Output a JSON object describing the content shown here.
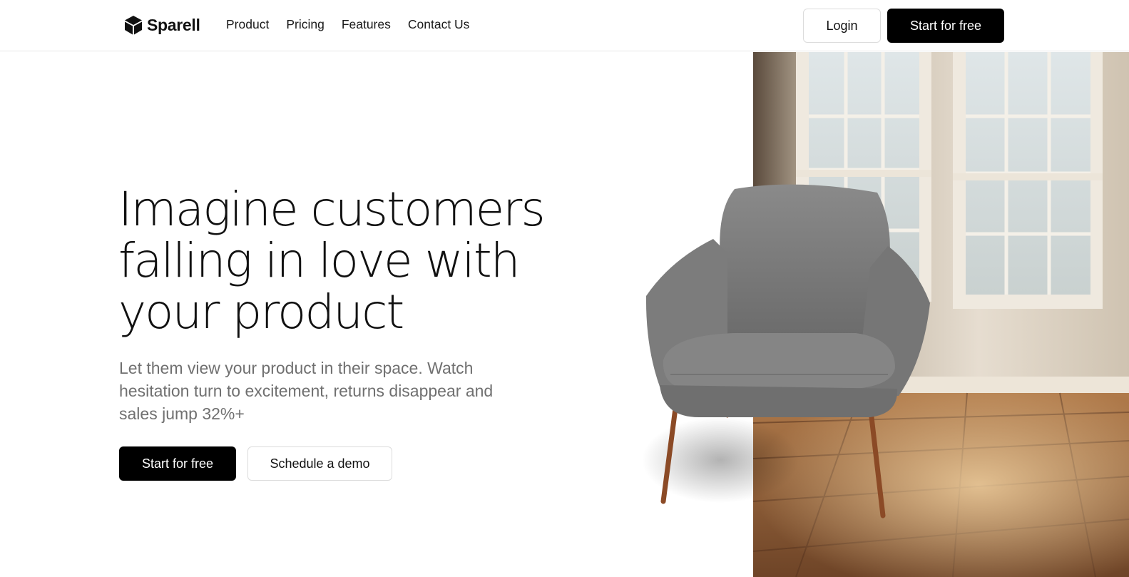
{
  "brand": {
    "name": "Sparell",
    "logo_icon": "cube-icon"
  },
  "nav": {
    "items": [
      {
        "label": "Product"
      },
      {
        "label": "Pricing"
      },
      {
        "label": "Features"
      },
      {
        "label": "Contact Us"
      }
    ]
  },
  "header": {
    "login_label": "Login",
    "start_label": "Start for free"
  },
  "hero": {
    "title": "Imagine customers falling in love with your product",
    "subtitle": "Let them view your product in their space. Watch hesitation turn to excitement, returns disappear and sales jump 32%+",
    "primary_cta": "Start for free",
    "secondary_cta": "Schedule a demo"
  },
  "colors": {
    "primary": "#000000",
    "muted_text": "#707070",
    "border": "#dcdcdc"
  }
}
